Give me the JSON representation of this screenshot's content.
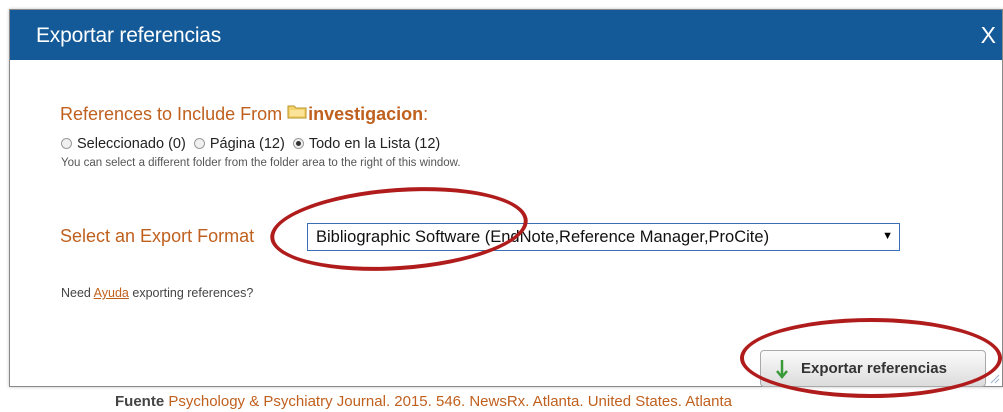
{
  "dialog": {
    "title": "Exportar referencias",
    "close_label": "X"
  },
  "include": {
    "label": "References to Include From",
    "folder_icon": "folder-icon",
    "folder_name": "investigacion",
    "suffix": ":",
    "options": [
      {
        "label": "Seleccionado (0)",
        "checked": false
      },
      {
        "label": "Página (12)",
        "checked": false
      },
      {
        "label": "Todo en la Lista (12)",
        "checked": true
      }
    ],
    "hint": "You can select a different folder from the folder area to the right of this window."
  },
  "format": {
    "label": "Select an Export Format",
    "selected": "Bibliographic Software (EndNote,Reference Manager,ProCite)"
  },
  "help": {
    "prefix": "Need ",
    "link": "Ayuda",
    "suffix": " exporting references?"
  },
  "export_button": {
    "label": "Exportar referencias"
  },
  "background": {
    "source_label": "Fuente",
    "source_text": "Psychology & Psychiatry Journal. 2015. 546. NewsRx. Atlanta. United States. Atlanta"
  },
  "colors": {
    "titlebar": "#145a99",
    "accent": "#c0601e",
    "annotation": "#b01c1c"
  }
}
